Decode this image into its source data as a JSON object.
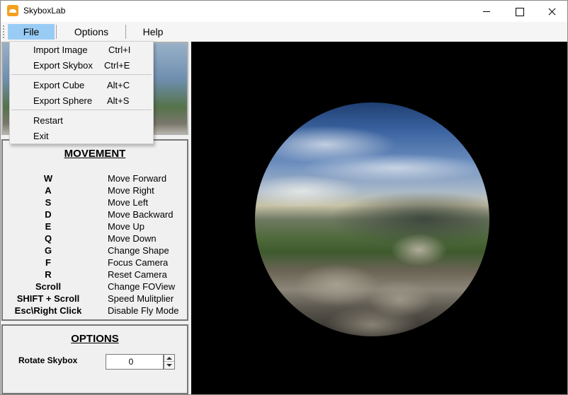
{
  "window": {
    "title": "SkyboxLab",
    "icon": "cloud-icon"
  },
  "menu": {
    "file": "File",
    "options": "Options",
    "help": "Help"
  },
  "file_menu": {
    "import_image": {
      "label": "Import Image",
      "shortcut": "Ctrl+I"
    },
    "export_skybox": {
      "label": "Export Skybox",
      "shortcut": "Ctrl+E"
    },
    "export_cube": {
      "label": "Export Cube",
      "shortcut": "Alt+C"
    },
    "export_sphere": {
      "label": "Export Sphere",
      "shortcut": "Alt+S"
    },
    "restart": {
      "label": "Restart"
    },
    "exit": {
      "label": "Exit"
    }
  },
  "movement": {
    "title": "MOVEMENT",
    "bindings": [
      {
        "key": "W",
        "action": "Move Forward"
      },
      {
        "key": "A",
        "action": "Move Right"
      },
      {
        "key": "S",
        "action": "Move Left"
      },
      {
        "key": "D",
        "action": "Move Backward"
      },
      {
        "key": "E",
        "action": "Move Up"
      },
      {
        "key": "Q",
        "action": "Move Down"
      },
      {
        "key": "G",
        "action": "Change Shape"
      },
      {
        "key": "F",
        "action": "Focus Camera"
      },
      {
        "key": "R",
        "action": "Reset Camera"
      },
      {
        "key": "Scroll",
        "action": "Change FOView"
      },
      {
        "key": "SHIFT + Scroll",
        "action": "Speed Mulitplier"
      },
      {
        "key": "Esc\\Right Click",
        "action": "Disable Fly Mode"
      }
    ]
  },
  "options": {
    "title": "OPTIONS",
    "rotate_label": "Rotate Skybox",
    "rotate_value": "0"
  },
  "colors": {
    "menu_highlight": "#99ccf5",
    "viewport_bg": "#000000",
    "panel_border": "#777777"
  }
}
